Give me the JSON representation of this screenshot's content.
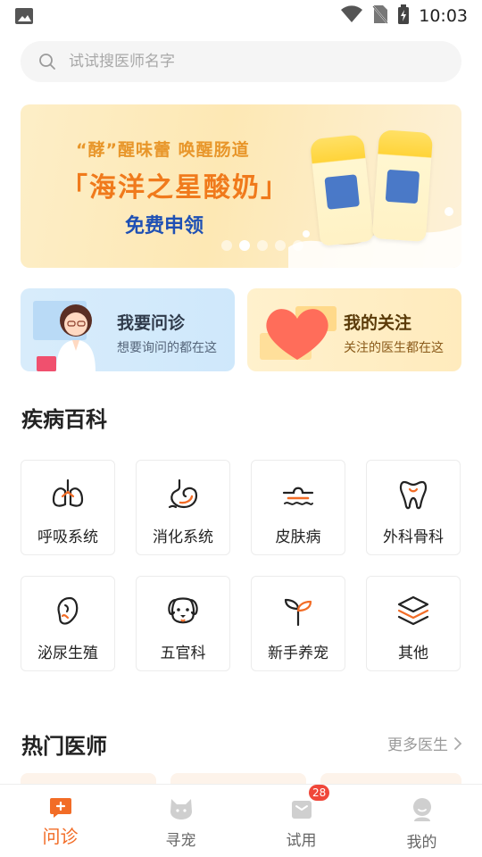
{
  "status_bar": {
    "time": "10:03"
  },
  "search": {
    "placeholder": "试试搜医师名字"
  },
  "banner": {
    "tag": "“酵”醒味蕾 唤醒肠道",
    "title": "「海洋之星酸奶」",
    "subtitle": "免费申领",
    "slide_count": 5,
    "active_slide": 2
  },
  "quick_cards": [
    {
      "title": "我要问诊",
      "desc": "想要询问的都在这",
      "icon": "doctor-illustration-icon"
    },
    {
      "title": "我的关注",
      "desc": "关注的医生都在这",
      "icon": "heart-icon"
    }
  ],
  "disease_section": {
    "title": "疾病百科",
    "items": [
      {
        "label": "呼吸系统",
        "icon": "lungs-icon"
      },
      {
        "label": "消化系统",
        "icon": "stomach-icon"
      },
      {
        "label": "皮肤病",
        "icon": "skin-icon"
      },
      {
        "label": "外科骨科",
        "icon": "tooth-bone-icon"
      },
      {
        "label": "泌尿生殖",
        "icon": "kidney-icon"
      },
      {
        "label": "五官科",
        "icon": "dog-face-icon"
      },
      {
        "label": "新手养宠",
        "icon": "sprout-icon"
      },
      {
        "label": "其他",
        "icon": "layers-icon"
      }
    ]
  },
  "doctor_section": {
    "title": "热门医师",
    "more_label": "更多医生"
  },
  "tabbar": {
    "tabs": [
      {
        "label": "问诊",
        "icon": "consult-icon",
        "active": true
      },
      {
        "label": "寻宠",
        "icon": "cat-icon",
        "active": false
      },
      {
        "label": "试用",
        "icon": "gift-box-icon",
        "active": false,
        "badge": "28"
      },
      {
        "label": "我的",
        "icon": "profile-icon",
        "active": false
      }
    ]
  },
  "colors": {
    "accent": "#f26c26",
    "badge": "#f0473a",
    "banner_title": "#f07a1c",
    "banner_sub": "#1e50b4"
  }
}
